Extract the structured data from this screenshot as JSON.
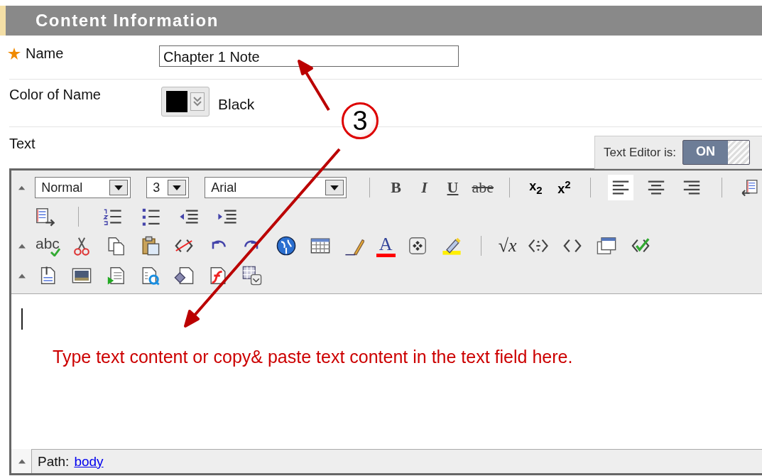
{
  "section_title": "Content Information",
  "name_field": {
    "label": "Name",
    "required": true,
    "value": "Chapter 1 Note"
  },
  "color_field": {
    "label": "Color of Name",
    "color": "#000000",
    "value": "Black"
  },
  "text_field": {
    "label": "Text"
  },
  "text_editor_toggle": {
    "label": "Text Editor is:",
    "state": "ON",
    "on": true
  },
  "toolbar": {
    "dropdowns": [
      {
        "value": "Normal",
        "kind": "wide"
      },
      {
        "value": "3",
        "kind": "narrow"
      },
      {
        "value": "Arial",
        "kind": "wider"
      }
    ],
    "format_buttons": [
      {
        "label": "B",
        "kind": "bold"
      },
      {
        "label": "I",
        "kind": "italic"
      },
      {
        "label": "U",
        "kind": "underline"
      },
      {
        "label": "abe",
        "kind": "strike"
      }
    ],
    "script_buttons": [
      {
        "label": "x$_{2}$"
      },
      {
        "label": "x$^{2}$"
      }
    ],
    "alignment_buttons": [
      {
        "kind": "left",
        "selected": true
      },
      {
        "kind": "center",
        "selected": false
      },
      {
        "kind": "right",
        "selected": false
      }
    ],
    "spellcheck_label": "abc",
    "font_color_label": "A",
    "equation_label": "√x"
  },
  "path": {
    "label": "Path:",
    "link": "body"
  },
  "annotation": {
    "badge": "3",
    "note": "Type text content or copy& paste text content in the text field here."
  }
}
